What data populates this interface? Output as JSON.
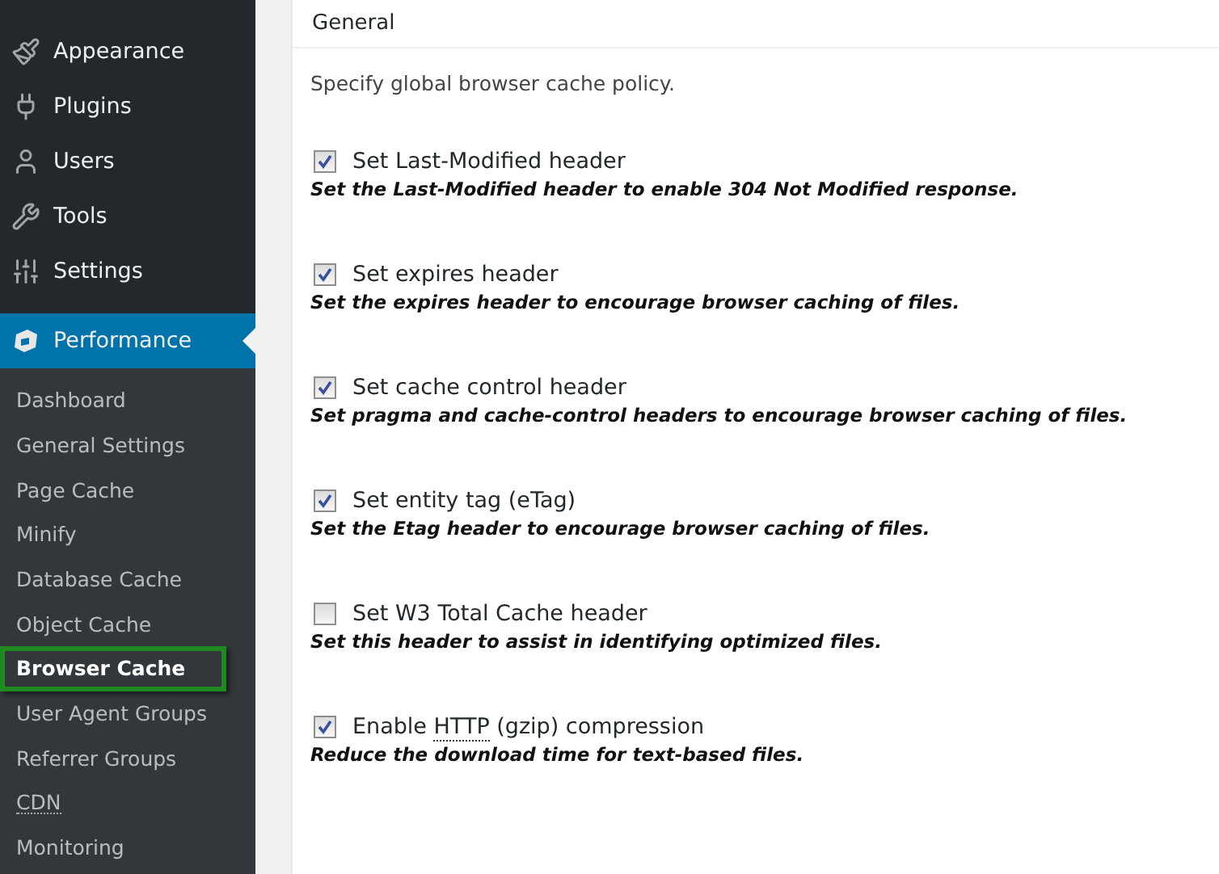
{
  "sidebar": {
    "menu": [
      {
        "label": "Appearance",
        "selected": false
      },
      {
        "label": "Plugins",
        "selected": false
      },
      {
        "label": "Users",
        "selected": false
      },
      {
        "label": "Tools",
        "selected": false
      },
      {
        "label": "Settings",
        "selected": false
      },
      {
        "label": "Performance",
        "selected": true
      }
    ],
    "submenu": [
      {
        "label": "Dashboard",
        "selected": false,
        "abbreviation": false
      },
      {
        "label": "General Settings",
        "selected": false,
        "abbreviation": false
      },
      {
        "label": "Page Cache",
        "selected": false,
        "abbreviation": false
      },
      {
        "label": "Minify",
        "selected": false,
        "abbreviation": false
      },
      {
        "label": "Database Cache",
        "selected": false,
        "abbreviation": false
      },
      {
        "label": "Object Cache",
        "selected": false,
        "abbreviation": false
      },
      {
        "label": "Browser Cache",
        "selected": true,
        "abbreviation": false
      },
      {
        "label": "User Agent Groups",
        "selected": false,
        "abbreviation": false
      },
      {
        "label": "Referrer Groups",
        "selected": false,
        "abbreviation": false
      },
      {
        "label": "CDN",
        "selected": false,
        "abbreviation": true
      },
      {
        "label": "Monitoring",
        "selected": false,
        "abbreviation": false
      }
    ]
  },
  "panel": {
    "title": "General",
    "intro": "Specify global browser cache policy.",
    "options": [
      {
        "label": [
          {
            "kind": "text",
            "text": "Set Last-Modified header"
          }
        ],
        "checked": true,
        "description": "Set the Last-Modified header to enable 304 Not Modified response."
      },
      {
        "label": [
          {
            "kind": "text",
            "text": "Set expires header"
          }
        ],
        "checked": true,
        "description": "Set the expires header to encourage browser caching of files."
      },
      {
        "label": [
          {
            "kind": "text",
            "text": "Set cache control header"
          }
        ],
        "checked": true,
        "description": "Set pragma and cache-control headers to encourage browser caching of files."
      },
      {
        "label": [
          {
            "kind": "text",
            "text": "Set entity tag (eTag)"
          }
        ],
        "checked": true,
        "description": "Set the Etag header to encourage browser caching of files."
      },
      {
        "label": [
          {
            "kind": "text",
            "text": "Set W3 Total Cache header"
          }
        ],
        "checked": false,
        "description": "Set this header to assist in identifying optimized files."
      },
      {
        "label": [
          {
            "kind": "text",
            "text": "Enable "
          },
          {
            "kind": "abbr",
            "text": "HTTP"
          },
          {
            "kind": "text",
            "text": " (gzip) compression"
          }
        ],
        "checked": true,
        "description": "Reduce the download time for text-based files."
      }
    ]
  }
}
